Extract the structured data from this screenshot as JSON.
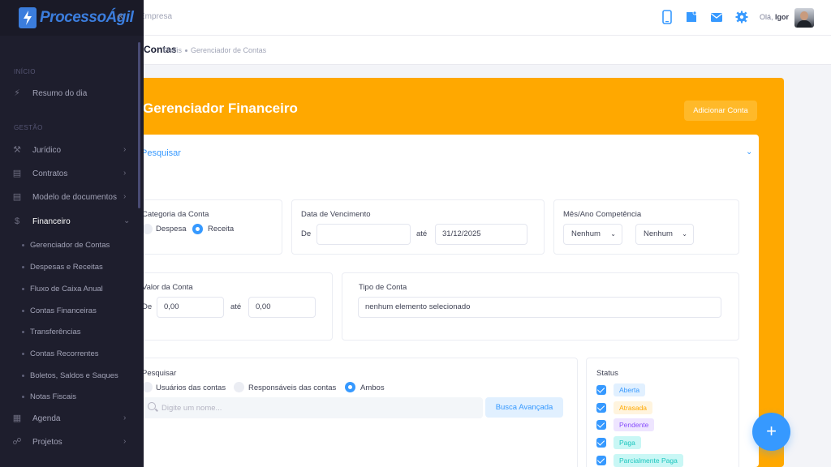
{
  "header": {
    "search_placeholder": "Empresa",
    "greeting": "Olá,",
    "user_name": "Igor"
  },
  "subheader": {
    "title": "Contas",
    "breadcrumb": [
      "Perfis",
      "Gerenciador de Contas"
    ]
  },
  "sidebar": {
    "brand": "ProcessoÁgil",
    "sections": {
      "inicio": "INÍCIO",
      "gestao": "GESTÃO"
    },
    "items": [
      {
        "label": "Resumo do dia",
        "icon": "bolt-icon"
      },
      {
        "label": "Jurídico",
        "icon": "hammer-icon"
      },
      {
        "label": "Contratos",
        "icon": "document-icon"
      },
      {
        "label": "Modelo de documentos",
        "icon": "document-icon"
      },
      {
        "label": "Financeiro",
        "icon": "dollar-icon"
      },
      {
        "label": "Agenda",
        "icon": "calendar-icon"
      },
      {
        "label": "Projetos",
        "icon": "diagram-icon"
      }
    ],
    "financeiro_sub": [
      "Gerenciador de Contas",
      "Despesas e Receitas",
      "Fluxo de Caixa Anual",
      "Contas Financeiras",
      "Transferências",
      "Contas Recorrentes",
      "Boletos, Saldos e Saques",
      "Notas Fiscais"
    ]
  },
  "main": {
    "title": "Gerenciador Financeiro",
    "add_button": "Adicionar Conta",
    "filter_toggle": "Pesquisar",
    "categoria": {
      "label": "Categoria da Conta",
      "opt_despesa": "Despesa",
      "opt_receita": "Receita",
      "selected": "Receita"
    },
    "vencimento": {
      "label": "Data de Vencimento",
      "from_label": "De",
      "from_value": "",
      "to_label": "até",
      "to_value": "31/12/2025"
    },
    "competencia": {
      "label": "Mês/Ano Competência",
      "month": "Nenhum",
      "year": "Nenhum"
    },
    "valor": {
      "label": "Valor da Conta",
      "from_label": "De",
      "from_value": "0,00",
      "to_label": "até",
      "to_value": "0,00"
    },
    "tipo": {
      "label": "Tipo de Conta",
      "value": "nenhum elemento selecionado"
    },
    "pesquisar": {
      "label": "Pesquisar",
      "opt_usuarios": "Usuários das contas",
      "opt_responsaveis": "Responsáveis das contas",
      "opt_ambos": "Ambos",
      "selected": "Ambos",
      "placeholder": "Digite um nome...",
      "advanced_button": "Busca Avançada"
    },
    "status": {
      "label": "Status",
      "items": [
        {
          "label": "Aberta",
          "checked": true,
          "bg": "#e1f0ff",
          "color": "#3699ff"
        },
        {
          "label": "Atrasada",
          "checked": true,
          "bg": "#fff4de",
          "color": "#ffa800"
        },
        {
          "label": "Pendente",
          "checked": true,
          "bg": "#eee5ff",
          "color": "#8950fc"
        },
        {
          "label": "Paga",
          "checked": true,
          "bg": "#c9f7f5",
          "color": "#1bc5bd"
        },
        {
          "label": "Parcialmente Paga",
          "checked": true,
          "bg": "#c9f7f5",
          "color": "#1bc5bd"
        }
      ]
    },
    "fab_label": "+"
  },
  "colors": {
    "accent": "#3699ff",
    "panel": "#ffa800",
    "sidebar": "#1e1e2d"
  }
}
